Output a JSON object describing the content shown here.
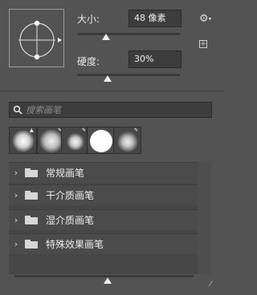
{
  "brush": {
    "size_label": "大小:",
    "size_value": "48 像素",
    "size_slider": 0.28,
    "hardness_label": "硬度:",
    "hardness_value": "30%",
    "hardness_slider": 0.3
  },
  "header_icons": {
    "settings_icon": "gear-with-dropdown",
    "new_preset_icon": "plus-square"
  },
  "search": {
    "placeholder": "搜索画笔",
    "value": ""
  },
  "recent_brushes": [
    {
      "name": "soft-round-pressure-size"
    },
    {
      "name": "soft-round-pressure-opacity"
    },
    {
      "name": "soft-round-small"
    },
    {
      "name": "hard-round-selected"
    },
    {
      "name": "soft-round-airbrush"
    }
  ],
  "brush_groups": [
    {
      "label": "常规画笔"
    },
    {
      "label": "干介质画笔"
    },
    {
      "label": "湿介质画笔"
    },
    {
      "label": "特殊效果画笔"
    }
  ],
  "thumbnail_size": 0.52
}
